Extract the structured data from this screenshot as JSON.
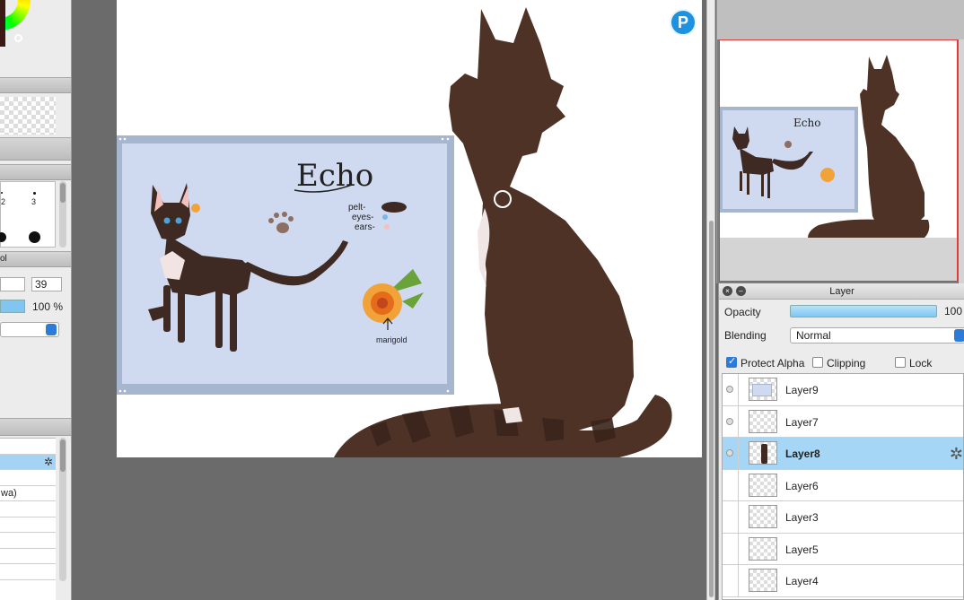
{
  "left_panel": {
    "brush_numbers": [
      "2",
      "3"
    ],
    "size_value": "39",
    "opacity_value": "100 %",
    "brush_list_partial": "wa)",
    "partial_label": "ol"
  },
  "canvas": {
    "refsheet_title": "Echo",
    "labels": [
      "pelt-",
      "eyes-",
      "ears-"
    ],
    "flower_label": "marigold"
  },
  "layer_panel": {
    "title": "Layer",
    "opacity_label": "Opacity",
    "opacity_value": "100",
    "opacity_fraction": 1.0,
    "blending_label": "Blending",
    "blending_value": "Normal",
    "protect_alpha_label": "Protect Alpha",
    "protect_alpha": true,
    "clipping_label": "Clipping",
    "clipping": false,
    "lock_label": "Lock",
    "lock": false,
    "layers": [
      {
        "name": "Layer9",
        "visible": true,
        "selected": false
      },
      {
        "name": "Layer7",
        "visible": true,
        "selected": false
      },
      {
        "name": "Layer8",
        "visible": true,
        "selected": true
      },
      {
        "name": "Layer6",
        "visible": false,
        "selected": false
      },
      {
        "name": "Layer3",
        "visible": false,
        "selected": false
      },
      {
        "name": "Layer5",
        "visible": false,
        "selected": false
      },
      {
        "name": "Layer4",
        "visible": false,
        "selected": false
      }
    ]
  },
  "colors": {
    "cat_brown": "#4e3226",
    "refsheet_bg": "#cfdaf0",
    "selection_blue": "#a5d6f5",
    "accent_blue": "#2c7bd8"
  }
}
